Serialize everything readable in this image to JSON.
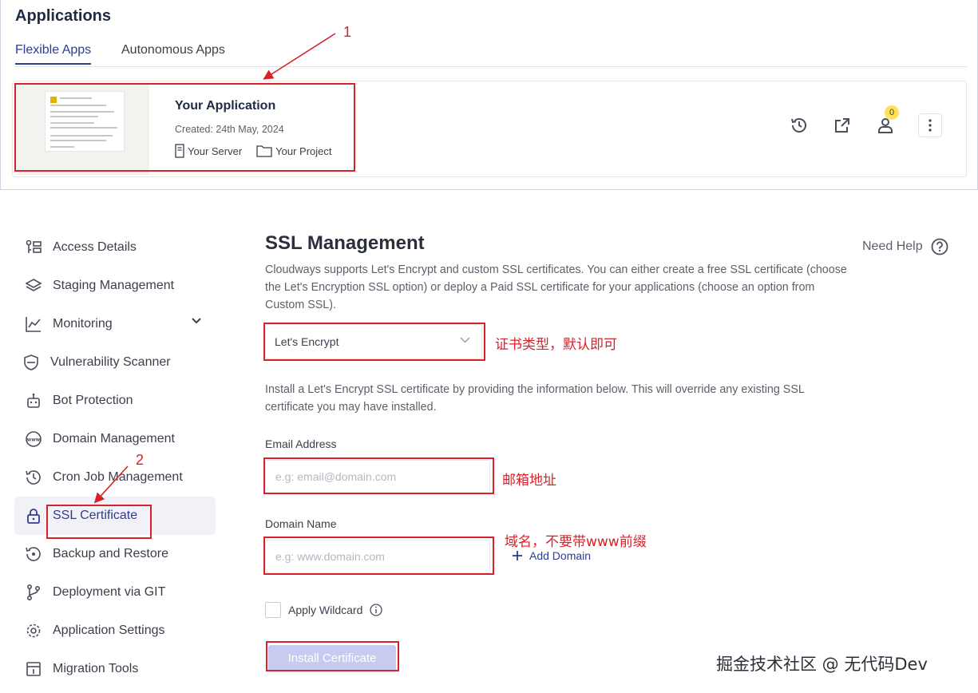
{
  "header": {
    "title": "Applications",
    "tabs": [
      {
        "label": "Flexible Apps",
        "active": true
      },
      {
        "label": "Autonomous Apps",
        "active": false
      }
    ]
  },
  "app_card": {
    "name": "Your Application",
    "created": "Created: 24th May, 2024",
    "server": "Your Server",
    "project": "Your Project",
    "collaborator_count": "0",
    "actions": [
      "history-icon",
      "external-link-icon",
      "user-icon",
      "more-vertical-icon"
    ]
  },
  "sidebar": {
    "items": [
      {
        "label": "Access Details",
        "icon": "access-details-icon"
      },
      {
        "label": "Staging Management",
        "icon": "layers-icon"
      },
      {
        "label": "Monitoring",
        "icon": "chart-line-icon"
      },
      {
        "label": "Vulnerability Scanner",
        "icon": "shield-scan-icon"
      },
      {
        "label": "Bot Protection",
        "icon": "robot-icon"
      },
      {
        "label": "Domain Management",
        "icon": "www-icon"
      },
      {
        "label": "Cron Job Management",
        "icon": "clock-history-icon"
      },
      {
        "label": "SSL Certificate",
        "icon": "lock-icon",
        "active": true
      },
      {
        "label": "Backup and Restore",
        "icon": "backup-icon"
      },
      {
        "label": "Deployment via GIT",
        "icon": "git-branch-icon"
      },
      {
        "label": "Application Settings",
        "icon": "gear-icon"
      },
      {
        "label": "Migration Tools",
        "icon": "migration-icon"
      }
    ]
  },
  "main": {
    "title": "SSL Management",
    "need_help": "Need Help",
    "intro": "Cloudways supports Let's Encrypt and custom SSL certificates. You can either create a free SSL certificate (choose the Let's Encryption SSL option) or deploy a Paid SSL certificate for your applications (choose an option from Custom SSL).",
    "ssl_type_selected": "Let's Encrypt",
    "install_info": "Install a Let's Encrypt SSL certificate by providing the information below. This will override any existing SSL certificate you may have installed.",
    "email_label": "Email Address",
    "email_placeholder": "e.g: email@domain.com",
    "domain_label": "Domain Name",
    "domain_placeholder": "e.g: www.domain.com",
    "add_domain": "Add Domain",
    "apply_wildcard": "Apply Wildcard",
    "install_button": "Install Certificate"
  },
  "annotations": {
    "marker_1": "1",
    "marker_2": "2",
    "note_ssl_type": "证书类型，默认即可",
    "note_email": "邮箱地址",
    "note_domain": "域名，不要带www前缀"
  },
  "watermark": "掘金技术社区 @ 无代码Dev",
  "colors": {
    "accent": "#2f3d8f",
    "annotation_red": "#d8222a",
    "button_disabled": "#c6cbef",
    "badge": "#ffe15a"
  }
}
